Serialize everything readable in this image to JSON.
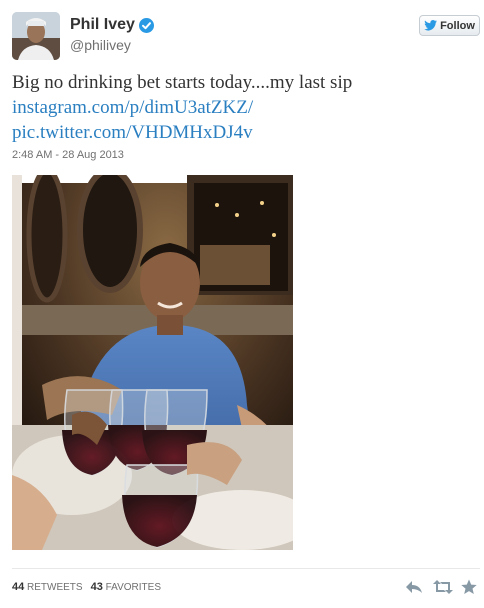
{
  "author": {
    "name": "Phil Ivey",
    "handle": "@philivey",
    "verified": true
  },
  "follow_button": {
    "label": "Follow"
  },
  "tweet": {
    "text": "Big no drinking bet starts today....my last sip",
    "links": [
      "instagram.com/p/dimU3atZKZ/",
      "pic.twitter.com/VHDMHxDJ4v"
    ],
    "timestamp": "2:48 AM - 28 Aug 2013"
  },
  "stats": {
    "retweets": "44",
    "retweets_label": "RETWEETS",
    "favorites": "43",
    "favorites_label": "FAVORITES"
  },
  "actions": [
    "reply-icon",
    "retweet-icon",
    "favorite-icon"
  ],
  "colors": {
    "link": "#2a7fc1",
    "verified": "#2a9ae4",
    "text": "#333333",
    "muted": "#707070"
  }
}
